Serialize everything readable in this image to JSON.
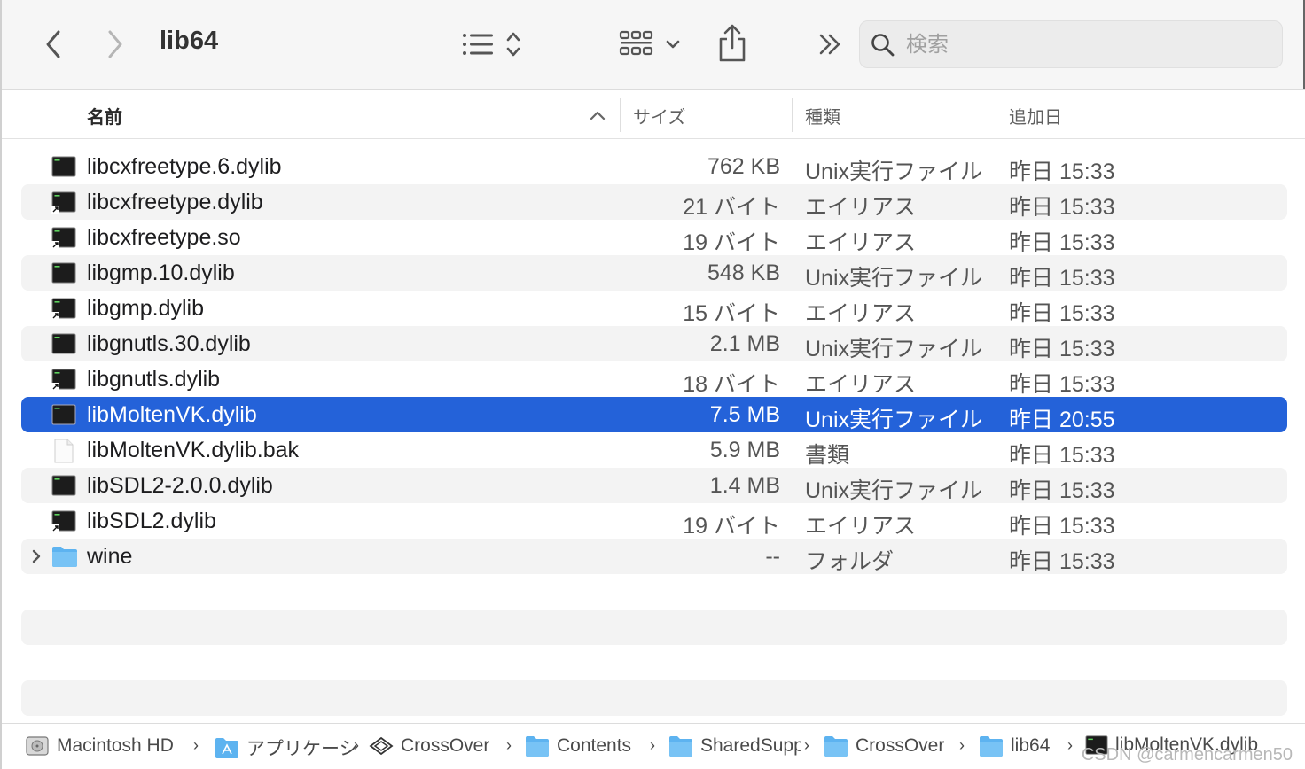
{
  "toolbar": {
    "title": "lib64",
    "search_placeholder": "検索"
  },
  "columns": {
    "name": "名前",
    "size": "サイズ",
    "kind": "種類",
    "date_added": "追加日"
  },
  "files": [
    {
      "name": "libcxfreetype.6.dylib",
      "size": "762 KB",
      "kind": "Unix実行ファイル",
      "date": "昨日 15:33",
      "icon": "unix-executable-icon",
      "alias": false
    },
    {
      "name": "libcxfreetype.dylib",
      "size": "21 バイト",
      "kind": "エイリアス",
      "date": "昨日 15:33",
      "icon": "alias-executable-icon",
      "alias": true
    },
    {
      "name": "libcxfreetype.so",
      "size": "19 バイト",
      "kind": "エイリアス",
      "date": "昨日 15:33",
      "icon": "alias-executable-icon",
      "alias": true
    },
    {
      "name": "libgmp.10.dylib",
      "size": "548 KB",
      "kind": "Unix実行ファイル",
      "date": "昨日 15:33",
      "icon": "unix-executable-icon",
      "alias": false
    },
    {
      "name": "libgmp.dylib",
      "size": "15 バイト",
      "kind": "エイリアス",
      "date": "昨日 15:33",
      "icon": "alias-executable-icon",
      "alias": true
    },
    {
      "name": "libgnutls.30.dylib",
      "size": "2.1 MB",
      "kind": "Unix実行ファイル",
      "date": "昨日 15:33",
      "icon": "unix-executable-icon",
      "alias": false
    },
    {
      "name": "libgnutls.dylib",
      "size": "18 バイト",
      "kind": "エイリアス",
      "date": "昨日 15:33",
      "icon": "alias-executable-icon",
      "alias": true
    },
    {
      "name": "libMoltenVK.dylib",
      "size": "7.5 MB",
      "kind": "Unix実行ファイル",
      "date": "昨日 20:55",
      "icon": "unix-executable-icon",
      "alias": false,
      "selected": true
    },
    {
      "name": "libMoltenVK.dylib.bak",
      "size": "5.9 MB",
      "kind": "書類",
      "date": "昨日 15:33",
      "icon": "document-icon",
      "alias": false
    },
    {
      "name": "libSDL2-2.0.0.dylib",
      "size": "1.4 MB",
      "kind": "Unix実行ファイル",
      "date": "昨日 15:33",
      "icon": "unix-executable-icon",
      "alias": false
    },
    {
      "name": "libSDL2.dylib",
      "size": "19 バイト",
      "kind": "エイリアス",
      "date": "昨日 15:33",
      "icon": "alias-executable-icon",
      "alias": true
    },
    {
      "name": "wine",
      "size": "--",
      "kind": "フォルダ",
      "date": "昨日 15:33",
      "icon": "folder-icon",
      "alias": false,
      "folder": true
    }
  ],
  "pathbar": [
    {
      "label": "Macintosh HD",
      "icon": "hard-drive-icon"
    },
    {
      "label": "アプリケーション",
      "icon": "applications-folder-icon"
    },
    {
      "label": "CrossOver",
      "icon": "crossover-app-icon"
    },
    {
      "label": "Contents",
      "icon": "folder-icon"
    },
    {
      "label": "SharedSupport",
      "icon": "folder-icon"
    },
    {
      "label": "CrossOver",
      "icon": "folder-icon"
    },
    {
      "label": "lib64",
      "icon": "folder-icon"
    },
    {
      "label": "libMoltenVK.dylib",
      "icon": "unix-executable-icon"
    }
  ],
  "watermark": "CSDN @carmencarmen50",
  "colors": {
    "selection": "#2462d9",
    "alt_row": "#f3f3f3",
    "folder": "#5db3f0"
  }
}
